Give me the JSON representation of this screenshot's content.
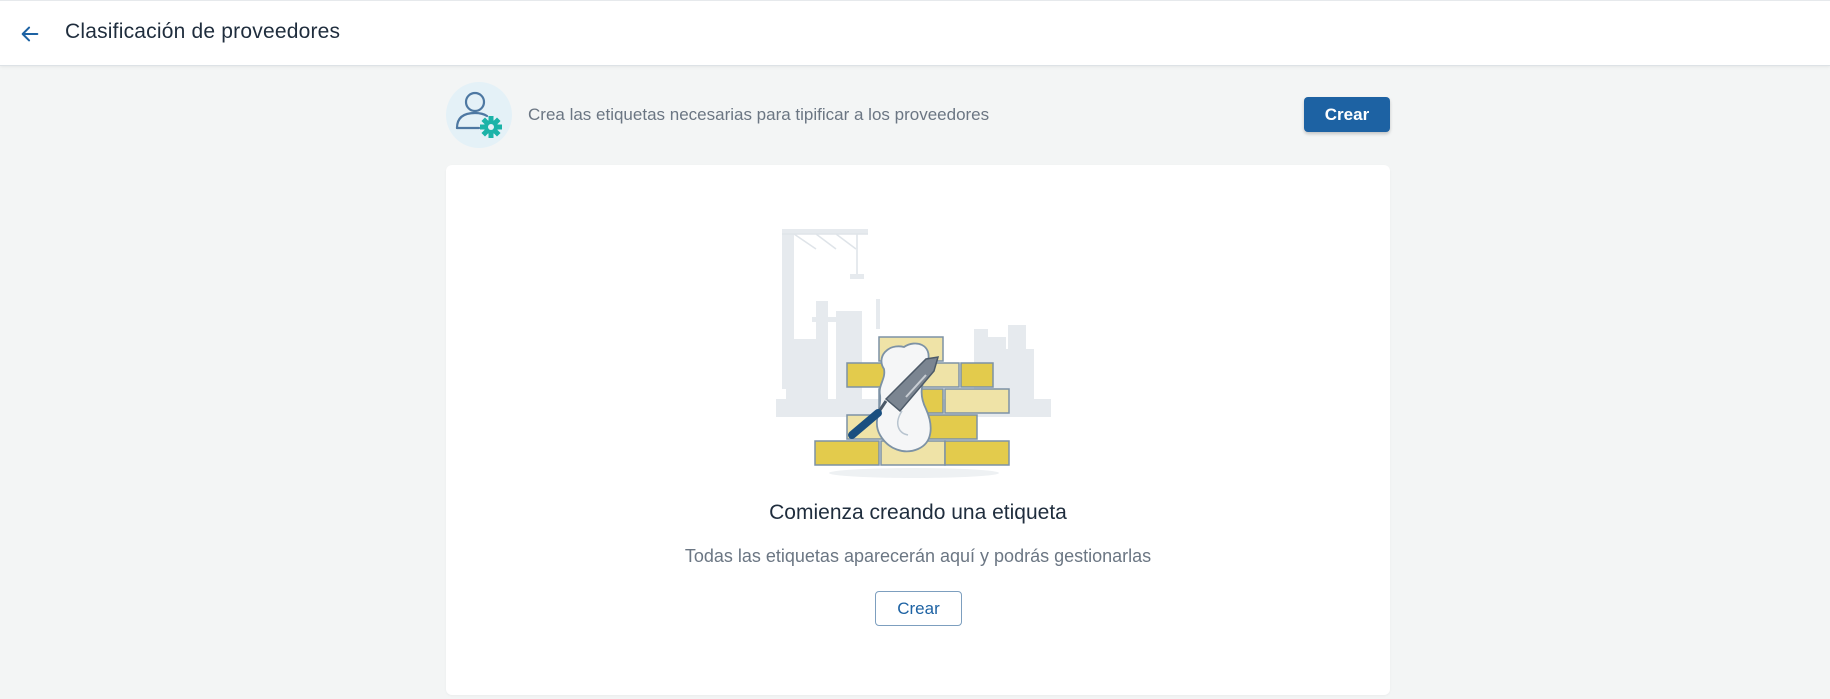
{
  "header": {
    "title": "Clasificación de proveedores",
    "back_icon": "arrow-left-icon"
  },
  "info": {
    "text": "Crea las etiquetas necesarias para tipificar a los proveedores",
    "icon": "user-gear-icon",
    "create_label": "Crear"
  },
  "empty_state": {
    "illustration": "brick-wall-trowel-illustration",
    "title": "Comienza creando una etiqueta",
    "subtitle": "Todas las etiquetas aparecerán aquí y podrás gestionarlas",
    "create_label": "Crear"
  },
  "colors": {
    "primary": "#1d62a3",
    "background": "#f3f5f5",
    "accent_teal": "#1bb3a8",
    "brick_yellow": "#e3cb4c"
  }
}
